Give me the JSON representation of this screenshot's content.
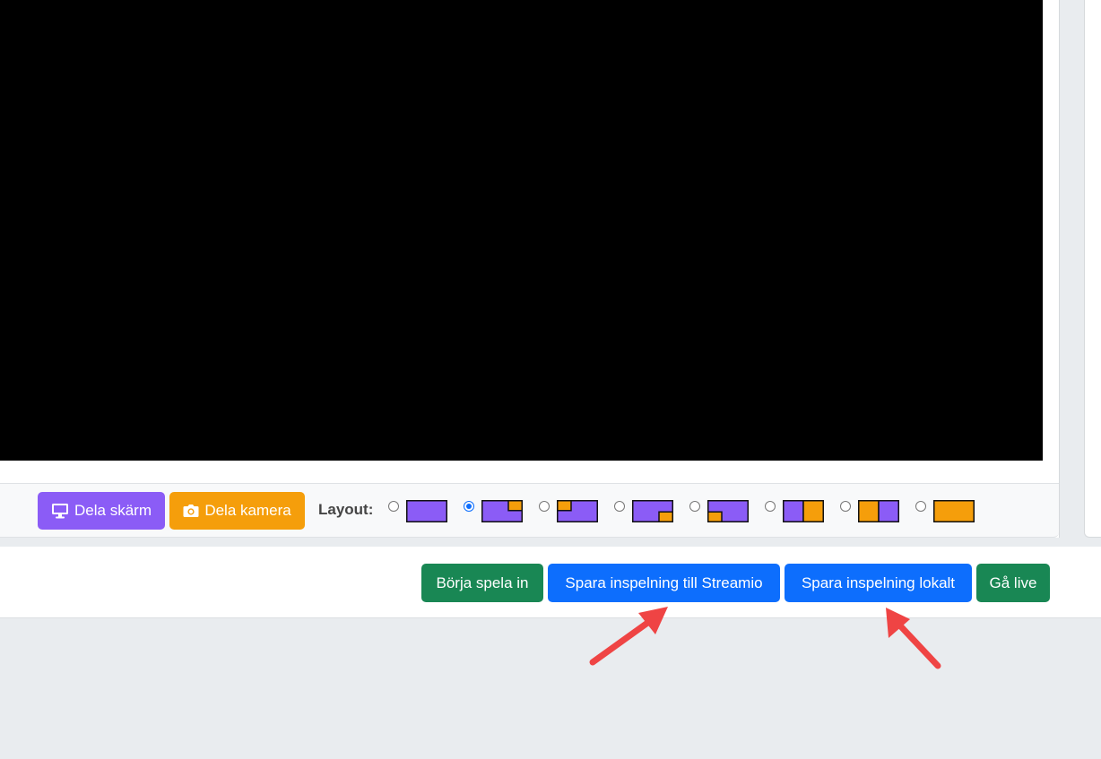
{
  "media_buttons": {
    "share_screen": "Dela skärm",
    "share_camera": "Dela kamera"
  },
  "layout": {
    "label": "Layout:",
    "selected_index": 1,
    "options": [
      {
        "name": "screen-only",
        "selected": false
      },
      {
        "name": "camera-top-right",
        "selected": true
      },
      {
        "name": "camera-top-left",
        "selected": false
      },
      {
        "name": "camera-bottom-right",
        "selected": false
      },
      {
        "name": "camera-bottom-left",
        "selected": false
      },
      {
        "name": "screen-left-camera-right",
        "selected": false
      },
      {
        "name": "camera-left-screen-right",
        "selected": false
      },
      {
        "name": "camera-only",
        "selected": false
      }
    ]
  },
  "actions": {
    "start_recording": "Börja spela in",
    "save_to_streamio": "Spara inspelning till Streamio",
    "save_locally": "Spara inspelning lokalt",
    "go_live": "Gå live"
  },
  "colors": {
    "screen": "#8b5cf6",
    "camera": "#f59e0b",
    "green": "#198754",
    "blue": "#0d6efd",
    "annotation_arrow": "#ef4444"
  }
}
